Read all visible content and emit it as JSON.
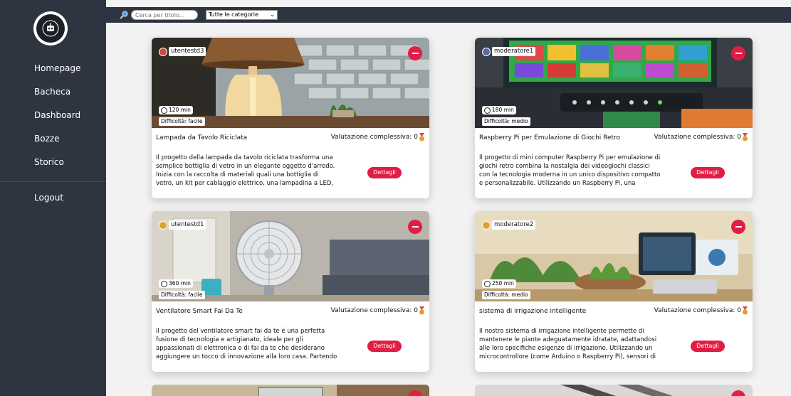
{
  "sidebar": {
    "items": [
      {
        "label": "Homepage"
      },
      {
        "label": "Bacheca"
      },
      {
        "label": "Dashboard"
      },
      {
        "label": "Bozze"
      },
      {
        "label": "Storico"
      }
    ],
    "logout": "Logout"
  },
  "topbar": {
    "search_placeholder": "Cerca per titolo...",
    "category_selected": "Tutte le categorie"
  },
  "cards": [
    {
      "user": "utentestd3",
      "time": "120 min",
      "difficulty": "Difficoltà: facile",
      "title": "Lampada da Tavolo Riciclata",
      "rating_label": "Valutazione complessiva:",
      "rating_value": "0",
      "description": "Il progetto della lampada da tavolo riciclata trasforma una semplice bottiglia di vetro in un elegante oggetto d'arredo. Inizia con la raccolta di materiali quali una bottiglia di vetro, un kit per cablaggio elettrico, una lampadina a LED, carta",
      "details": "Dettagli"
    },
    {
      "user": "moderatore1",
      "time": "180 min",
      "difficulty": "Difficoltà: medio",
      "title": "Raspberry Pi per Emulazione di Giochi Retro",
      "rating_label": "Valutazione complessiva:",
      "rating_value": "0",
      "description": "Il progetto di mini computer Raspberry Pi per emulazione di giochi retro combina la nostalgia dei videogiochi classici con la tecnologia moderna in un unico dispositivo compatto e personalizzabile. Utilizzando un Raspberry Pi, una microSD",
      "details": "Dettagli"
    },
    {
      "user": "utentestd1",
      "time": "360 min",
      "difficulty": "Difficoltà: facile",
      "title": "Ventilatore Smart Fai Da Te",
      "rating_label": "Valutazione complessiva:",
      "rating_value": "0",
      "description": "Il progetto del ventilatore smart fai da te è una perfetta fusione di tecnologia e artigianato, ideale per gli appassionati di elettronica e di fai da te che desiderano aggiungere un tocco di innovazione alla loro casa. Partendo dalla raccolta dei",
      "details": "Dettagli"
    },
    {
      "user": "moderatore2",
      "time": "250 min",
      "difficulty": "Difficoltà: medio",
      "title": "sistema di irrigazione intelligente",
      "rating_label": "Valutazione complessiva:",
      "rating_value": "0",
      "description": "Il nostro sistema di irrigazione intelligente permette di mantenere le piante adeguatamente idratate, adattandosi alle loro specifiche esigenze di irrigazione. Utilizzando un microcontrollore (come Arduino o Raspberry Pi), sensori di",
      "details": "Dettagli"
    }
  ],
  "colors": {
    "sidebar_bg": "#2f3441",
    "accent": "#e01e45",
    "page_bg": "#f2f2f2"
  }
}
